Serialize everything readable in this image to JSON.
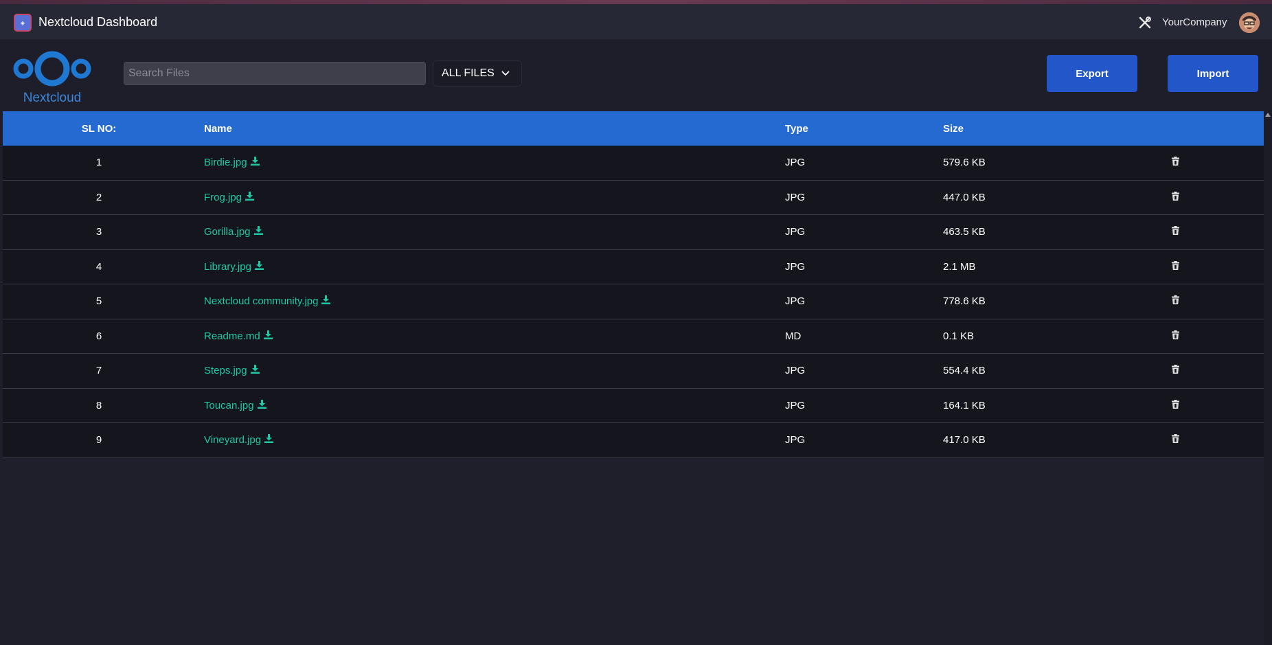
{
  "window": {
    "title": "Nextcloud Dashboard",
    "company": "YourCompany"
  },
  "header": {
    "logo_text": "Nextcloud",
    "search_placeholder": "Search Files",
    "filter_label": "ALL FILES",
    "export_label": "Export",
    "import_label": "Import"
  },
  "table": {
    "headers": {
      "sl": "SL NO:",
      "name": "Name",
      "type": "Type",
      "size": "Size"
    },
    "rows": [
      {
        "sl": "1",
        "name": "Birdie.jpg",
        "type": "JPG",
        "size": "579.6 KB"
      },
      {
        "sl": "2",
        "name": "Frog.jpg",
        "type": "JPG",
        "size": "447.0 KB"
      },
      {
        "sl": "3",
        "name": "Gorilla.jpg",
        "type": "JPG",
        "size": "463.5 KB"
      },
      {
        "sl": "4",
        "name": "Library.jpg",
        "type": "JPG",
        "size": "2.1 MB"
      },
      {
        "sl": "5",
        "name": "Nextcloud community.jpg",
        "type": "JPG",
        "size": "778.6 KB"
      },
      {
        "sl": "6",
        "name": "Readme.md",
        "type": "MD",
        "size": "0.1 KB"
      },
      {
        "sl": "7",
        "name": "Steps.jpg",
        "type": "JPG",
        "size": "554.4 KB"
      },
      {
        "sl": "8",
        "name": "Toucan.jpg",
        "type": "JPG",
        "size": "164.1 KB"
      },
      {
        "sl": "9",
        "name": "Vineyard.jpg",
        "type": "JPG",
        "size": "417.0 KB"
      }
    ]
  },
  "icons": {
    "download": "download-icon",
    "delete": "trash-icon",
    "tools": "tools-icon",
    "filter_chevron": "chevron-down-icon"
  },
  "colors": {
    "accent_blue": "#246ad1",
    "button_blue": "#2356c8",
    "file_link": "#1fc8a4",
    "background": "#1e1f2b"
  }
}
